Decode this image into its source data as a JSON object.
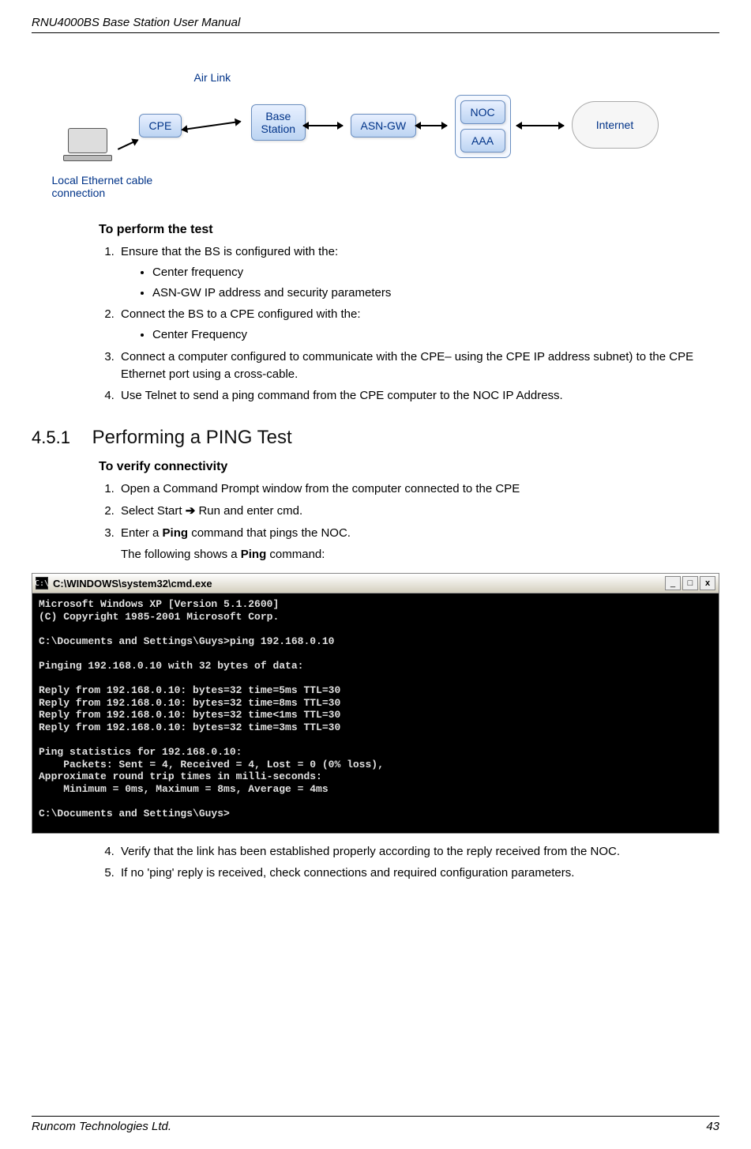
{
  "header": {
    "left": "RNU4000BS Base Station User Manual"
  },
  "footer": {
    "left": "Runcom Technologies Ltd.",
    "right": "43"
  },
  "diagram": {
    "air_link_label": "Air Link",
    "cpe": "CPE",
    "base_station": "Base\nStation",
    "asn_gw": "ASN-GW",
    "noc": "NOC",
    "aaa": "AAA",
    "internet": "Internet",
    "local_eth_label": "Local Ethernet cable\nconnection"
  },
  "steps_perform": {
    "title": "To perform the test",
    "s1": "Ensure that the BS is configured with the:",
    "s1b1": "Center frequency",
    "s1b2": "ASN-GW IP address and security parameters",
    "s2": "Connect the BS to a CPE configured with the:",
    "s2b1": "Center Frequency",
    "s3": "Connect a computer configured to communicate with the CPE– using the CPE IP address subnet) to the CPE Ethernet port using a cross-cable.",
    "s4": "Use Telnet to send a ping command from the CPE computer to the NOC IP Address."
  },
  "section": {
    "num": "4.5.1",
    "title": "Performing a PING Test"
  },
  "verify": {
    "title": "To verify connectivity",
    "s1": "Open a Command Prompt window from the computer connected to the CPE",
    "s2a": "Select Start ",
    "s2arrow": "➔",
    "s2b": " Run and enter cmd.",
    "s3a": "Enter a ",
    "s3bold": "Ping",
    "s3b": " command that pings the NOC.",
    "s3c_a": "The following shows a ",
    "s3c_bold": "Ping",
    "s3c_b": " command:",
    "s4": "Verify that the link has been established properly according to the reply received from the NOC.",
    "s5": "If no 'ping' reply is received, check connections and required configuration parameters."
  },
  "cmd": {
    "title": "C:\\WINDOWS\\system32\\cmd.exe",
    "icon_text": "C:\\",
    "btn_min": "_",
    "btn_max": "□",
    "btn_close": "x",
    "body": "Microsoft Windows XP [Version 5.1.2600]\n(C) Copyright 1985-2001 Microsoft Corp.\n\nC:\\Documents and Settings\\Guys>ping 192.168.0.10\n\nPinging 192.168.0.10 with 32 bytes of data:\n\nReply from 192.168.0.10: bytes=32 time=5ms TTL=30\nReply from 192.168.0.10: bytes=32 time=8ms TTL=30\nReply from 192.168.0.10: bytes=32 time<1ms TTL=30\nReply from 192.168.0.10: bytes=32 time=3ms TTL=30\n\nPing statistics for 192.168.0.10:\n    Packets: Sent = 4, Received = 4, Lost = 0 (0% loss),\nApproximate round trip times in milli-seconds:\n    Minimum = 0ms, Maximum = 8ms, Average = 4ms\n\nC:\\Documents and Settings\\Guys>"
  }
}
